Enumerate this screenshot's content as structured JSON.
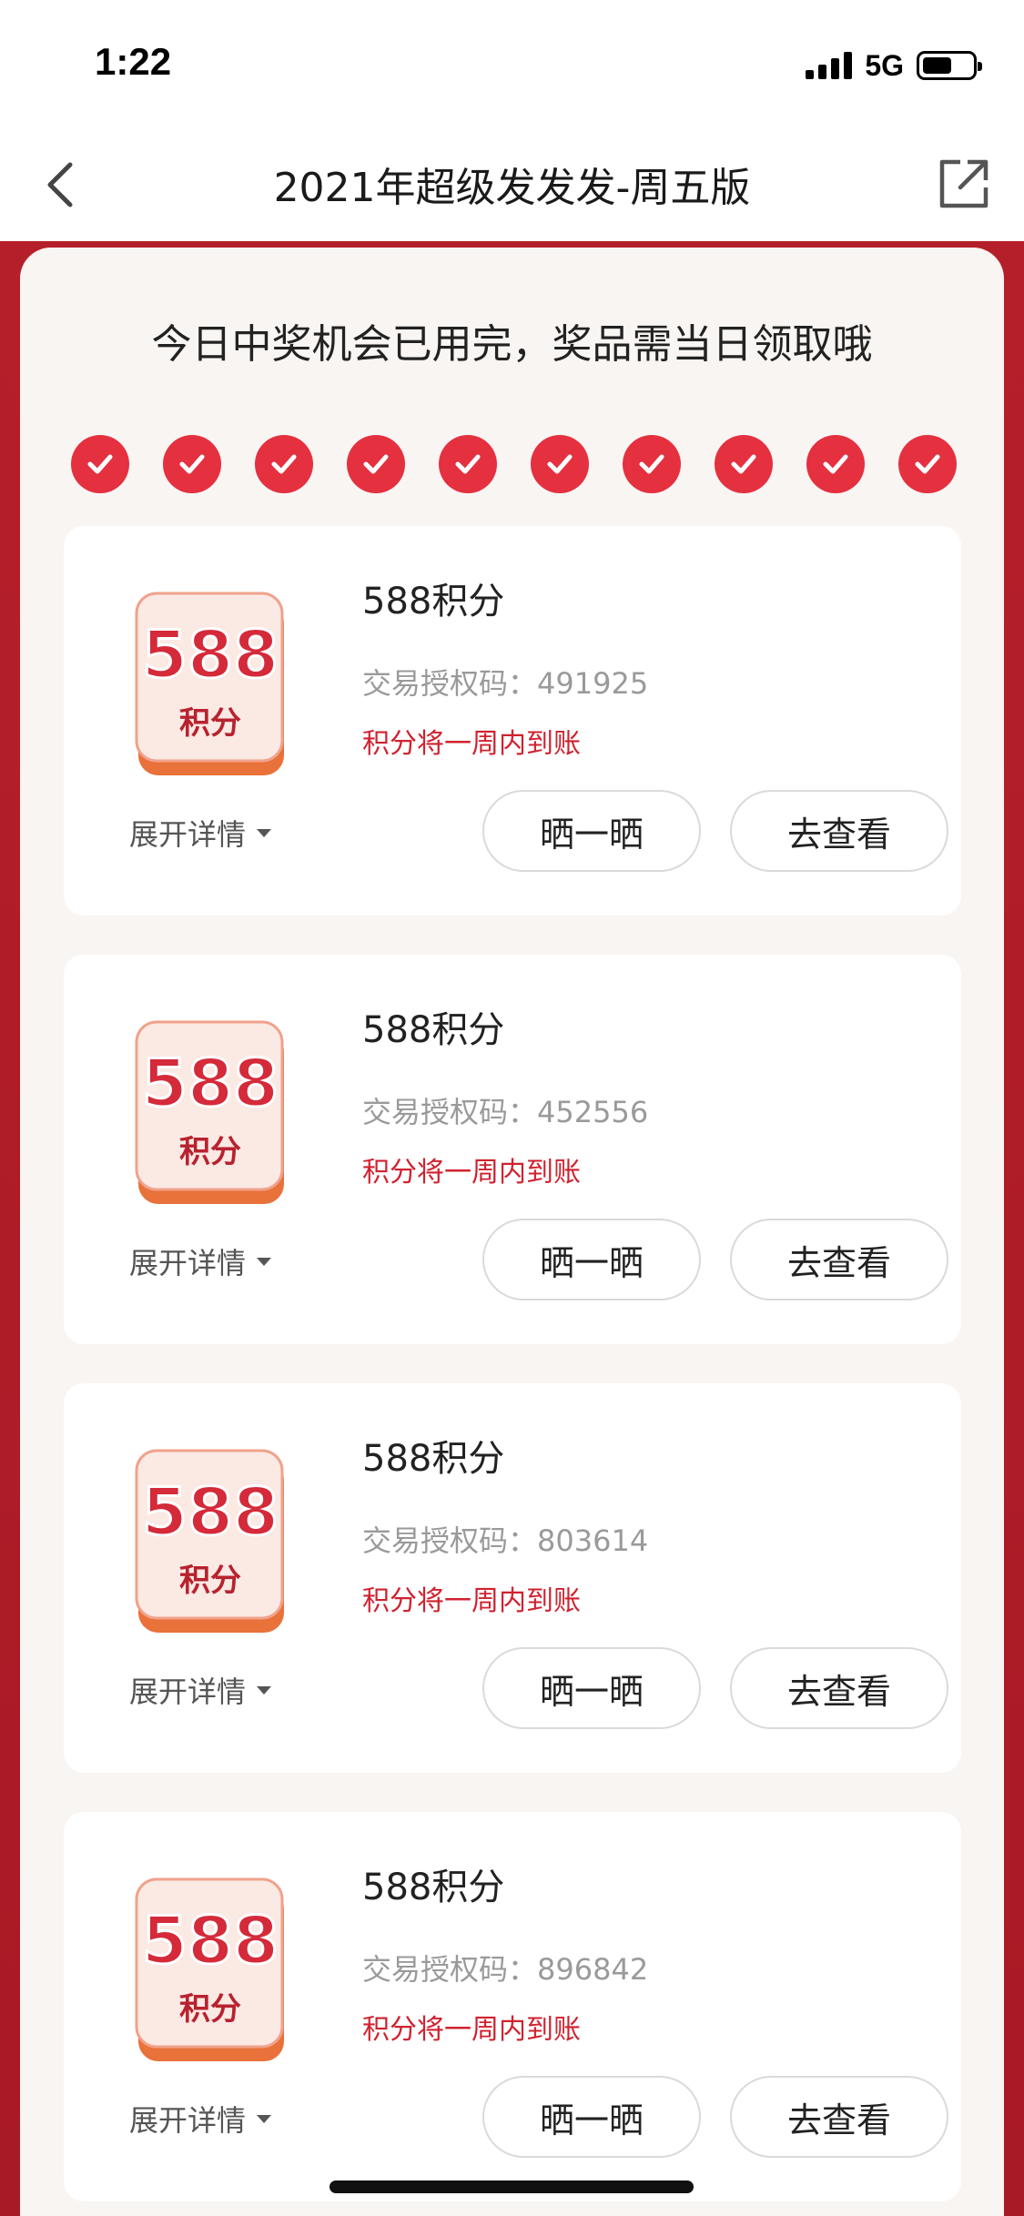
{
  "status_bar": {
    "time": "1:22",
    "network": "5G",
    "battery_level": 0.6
  },
  "nav": {
    "title": "2021年超级发发发-周五版",
    "back_icon": "chevron-left-icon",
    "share_icon": "share-external-icon"
  },
  "panel": {
    "message": "今日中奖机会已用完，奖品需当日领取哦",
    "chances_used": 10,
    "chances_total": 10
  },
  "prizes": [
    {
      "badge_number": "588",
      "badge_unit": "积分",
      "name": "588积分",
      "code_label": "交易授权码：",
      "code": "491925",
      "notice": "积分将一周内到账",
      "details_label": "展开详情",
      "share_label": "晒一晒",
      "view_label": "去查看"
    },
    {
      "badge_number": "588",
      "badge_unit": "积分",
      "name": "588积分",
      "code_label": "交易授权码：",
      "code": "452556",
      "notice": "积分将一周内到账",
      "details_label": "展开详情",
      "share_label": "晒一晒",
      "view_label": "去查看"
    },
    {
      "badge_number": "588",
      "badge_unit": "积分",
      "name": "588积分",
      "code_label": "交易授权码：",
      "code": "803614",
      "notice": "积分将一周内到账",
      "details_label": "展开详情",
      "share_label": "晒一晒",
      "view_label": "去查看"
    },
    {
      "badge_number": "588",
      "badge_unit": "积分",
      "name": "588积分",
      "code_label": "交易授权码：",
      "code": "896842",
      "notice": "积分将一周内到账",
      "details_label": "展开详情",
      "share_label": "晒一晒",
      "view_label": "去查看"
    }
  ],
  "colors": {
    "accent_red": "#e53040",
    "frame_red": "#b51f2a",
    "notice_red": "#d0222f"
  }
}
